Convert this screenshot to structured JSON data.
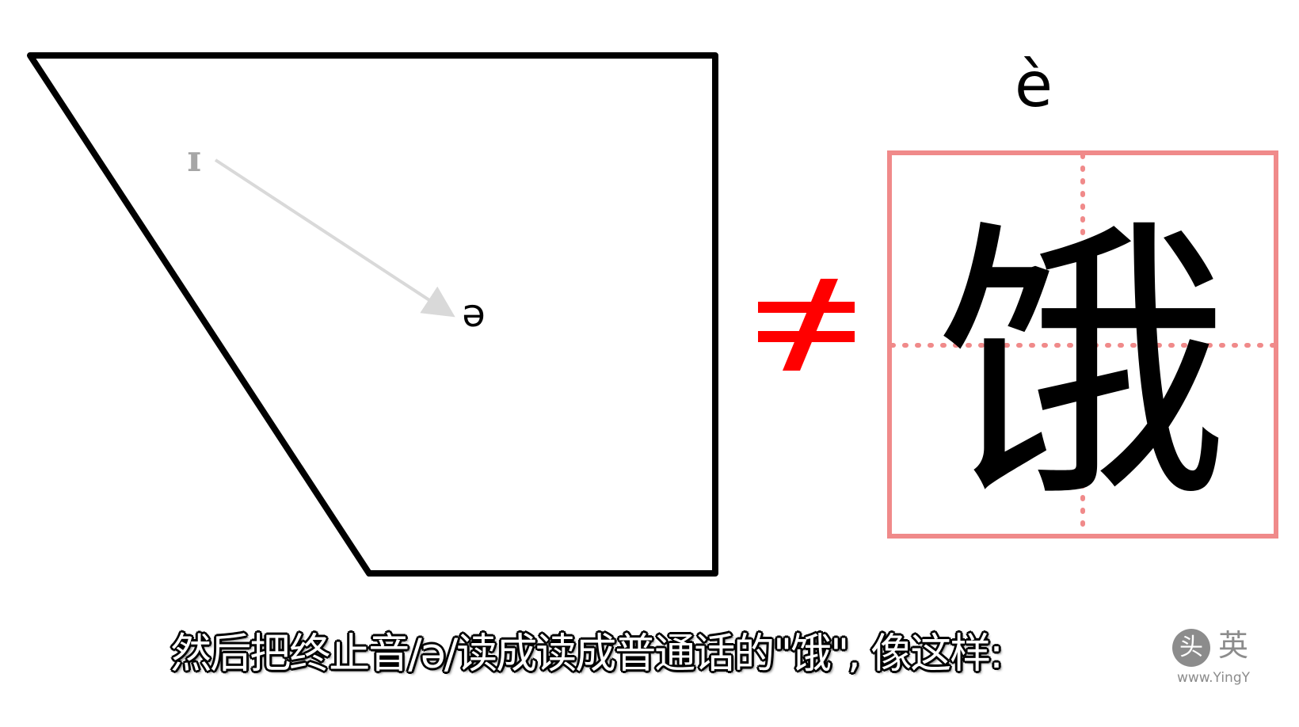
{
  "vowel_chart": {
    "start_symbol": "ɪ",
    "end_symbol": "ə"
  },
  "comparison_sign": "≠",
  "hanzi": {
    "pinyin": "è",
    "character": "饿"
  },
  "subtitle": "然后把终止音/ə/读成读成普通话的\"饿\", 像这样:",
  "watermark": {
    "logo_glyph": "头",
    "brand_char": "英",
    "url": "www.YingY"
  },
  "colors": {
    "outline": "#000000",
    "arrow": "#d9d9d9",
    "start_symbol": "#a6a6a6",
    "not_equal": "#ff0000",
    "grid_border": "#f08a8a",
    "grid_guides": "#f08a8a",
    "watermark": "#8c8c8c"
  }
}
